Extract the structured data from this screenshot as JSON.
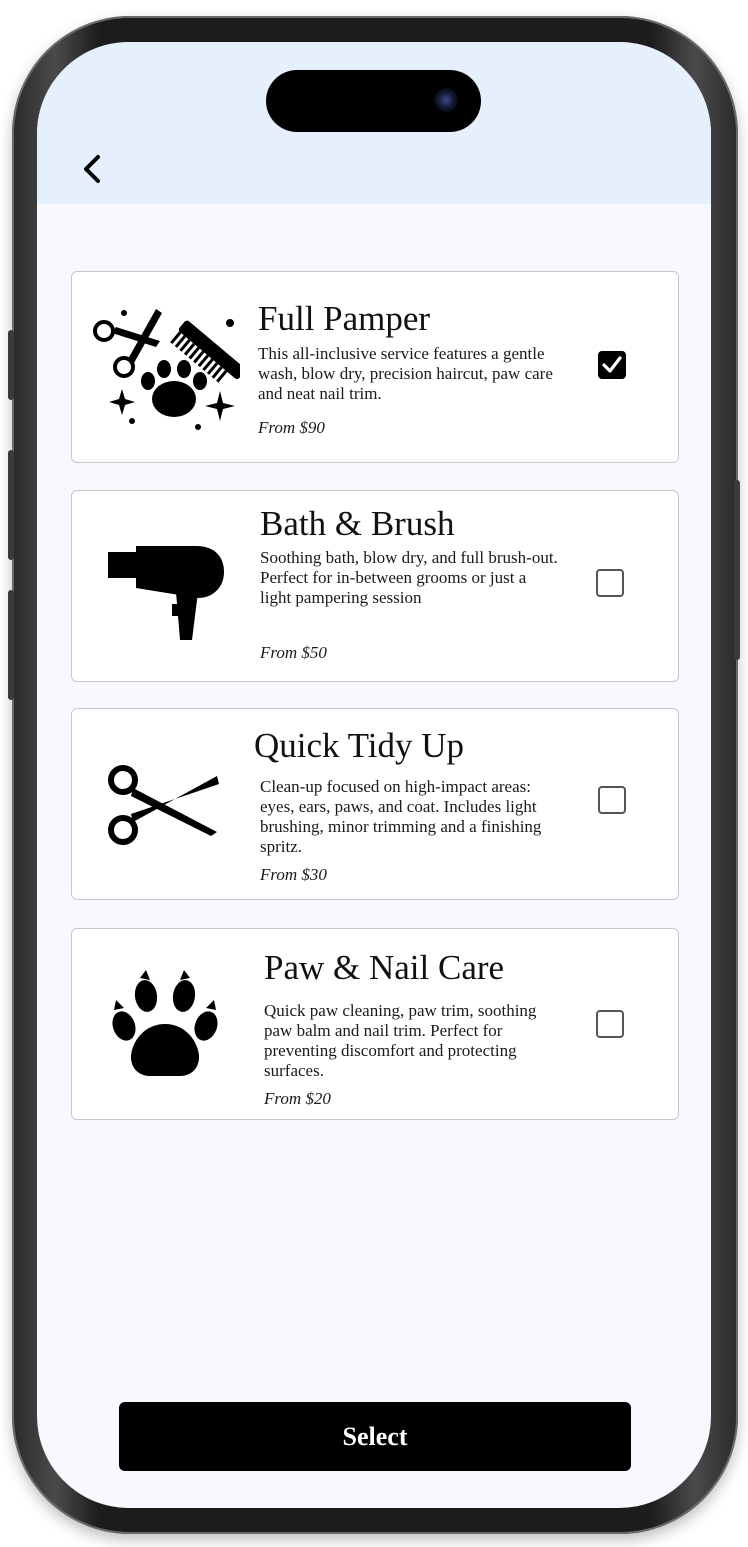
{
  "services": [
    {
      "title": "Full Pamper",
      "description": "This all-inclusive service features a gentle wash, blow dry, precision haircut, paw care and neat nail trim.",
      "price": "From $90",
      "icon": "grooming-kit-icon",
      "selected": true
    },
    {
      "title": "Bath & Brush",
      "description": "Soothing bath, blow dry, and full brush-out. Perfect for in-between grooms or just a light pampering session",
      "price": "From $50",
      "icon": "hair-dryer-icon",
      "selected": false
    },
    {
      "title": "Quick Tidy Up",
      "description": "Clean-up focused on high-impact areas: eyes, ears, paws, and coat. Includes light brushing, minor trimming and a finishing spritz.",
      "price": "From $30",
      "icon": "scissors-icon",
      "selected": false
    },
    {
      "title": "Paw & Nail Care",
      "description": "Quick paw cleaning, paw trim, soothing paw balm and nail trim. Perfect for preventing discomfort and protecting surfaces.",
      "price": "From $20",
      "icon": "paw-icon",
      "selected": false
    }
  ],
  "footer": {
    "select_label": "Select"
  },
  "colors": {
    "header_bg": "#e6effc",
    "screen_bg": "#f7f9fe",
    "button_bg": "#000000"
  }
}
